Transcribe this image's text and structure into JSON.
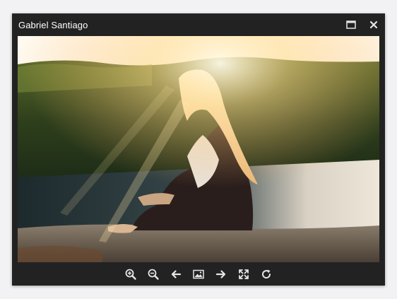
{
  "window": {
    "title": "Gabriel Santiago",
    "maximize_icon": "maximize-icon",
    "close_icon": "close-icon"
  },
  "image": {
    "subject": "photo-viewer-image"
  },
  "toolbar": {
    "tools": [
      {
        "name": "zoom-in",
        "icon": "zoom-in-icon"
      },
      {
        "name": "zoom-out",
        "icon": "zoom-out-icon"
      },
      {
        "name": "previous",
        "icon": "arrow-left-icon"
      },
      {
        "name": "reset",
        "icon": "image-icon"
      },
      {
        "name": "next",
        "icon": "arrow-right-icon"
      },
      {
        "name": "fullscreen",
        "icon": "fullscreen-icon"
      },
      {
        "name": "rotate",
        "icon": "rotate-right-icon"
      }
    ]
  },
  "colors": {
    "frame": "#222222",
    "icon": "#e6e6e6",
    "page_background": "#f2f2f4"
  }
}
